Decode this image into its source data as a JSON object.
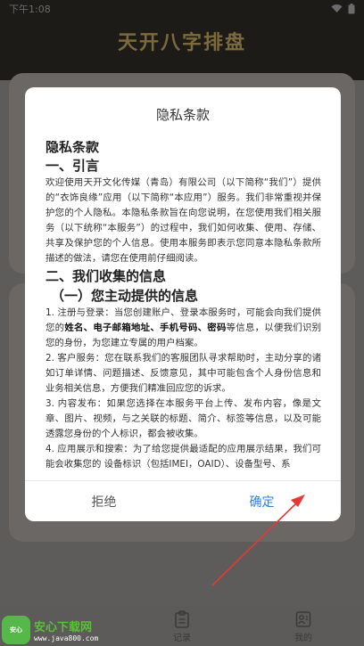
{
  "status_bar": {
    "time": "下午1:08",
    "icons": [
      "wifi-icon",
      "battery-icon"
    ]
  },
  "app": {
    "title": "天开八字排盘"
  },
  "tabbar": {
    "items": [
      {
        "label": "",
        "icon": "home-icon"
      },
      {
        "label": "记录",
        "icon": "clipboard-icon"
      },
      {
        "label": "我的",
        "icon": "profile-icon"
      }
    ]
  },
  "watermark": {
    "brand": "安心下载网",
    "url": "www.java800.com",
    "logo_text": "安心\n下载"
  },
  "modal": {
    "title": "隐私条款",
    "heading": "隐私条款",
    "section1": "一、引言",
    "intro": "欢迎使用天开文化传媒（青岛）有限公司（以下简称“我们”）提供的“衣饰良缘”应用（以下简称“本应用”）服务。我们非常重视并保护您的个人隐私。本隐私条款旨在向您说明，在您使用我们相关服务（以下统称“本服务”）的过程中，我们如何收集、使用、存储、共享及保护您的个人信息。使用本服务即表示您同意本隐私条款所描述的做法，请您在使用前仔细阅读。",
    "section2": "二、我们收集的信息",
    "section2_1": "（一）您主动提供的信息",
    "item1_pre": "1. 注册与登录：当您创建账户、登录本服务时，可能会向我们提供您的",
    "item1_bold": "姓名、电子邮箱地址、手机号码、密码",
    "item1_post": "等信息，以便我们识别您的身份，为您建立专属的用户档案。",
    "item2": "2. 客户服务：您在联系我们的客服团队寻求帮助时，主动分享的诸如订单详情、问题描述、反馈意见，其中可能包含个人身份信息和业务相关信息，方便我们精准回应您的诉求。",
    "item3": "3. 内容发布：如果您选择在本服务平台上传、发布内容，像是文章、图片、视频，与之关联的标题、简介、标签等信息，以及可能透露您身份的个人标识，都会被收集。",
    "item4": "4. 应用展示和搜索：为了给您提供最适配的应用展示结果，我们可能会收集您的 设备标识（包括IMEI，OAID）、设备型号、系",
    "reject_label": "拒绝",
    "confirm_label": "确定"
  }
}
